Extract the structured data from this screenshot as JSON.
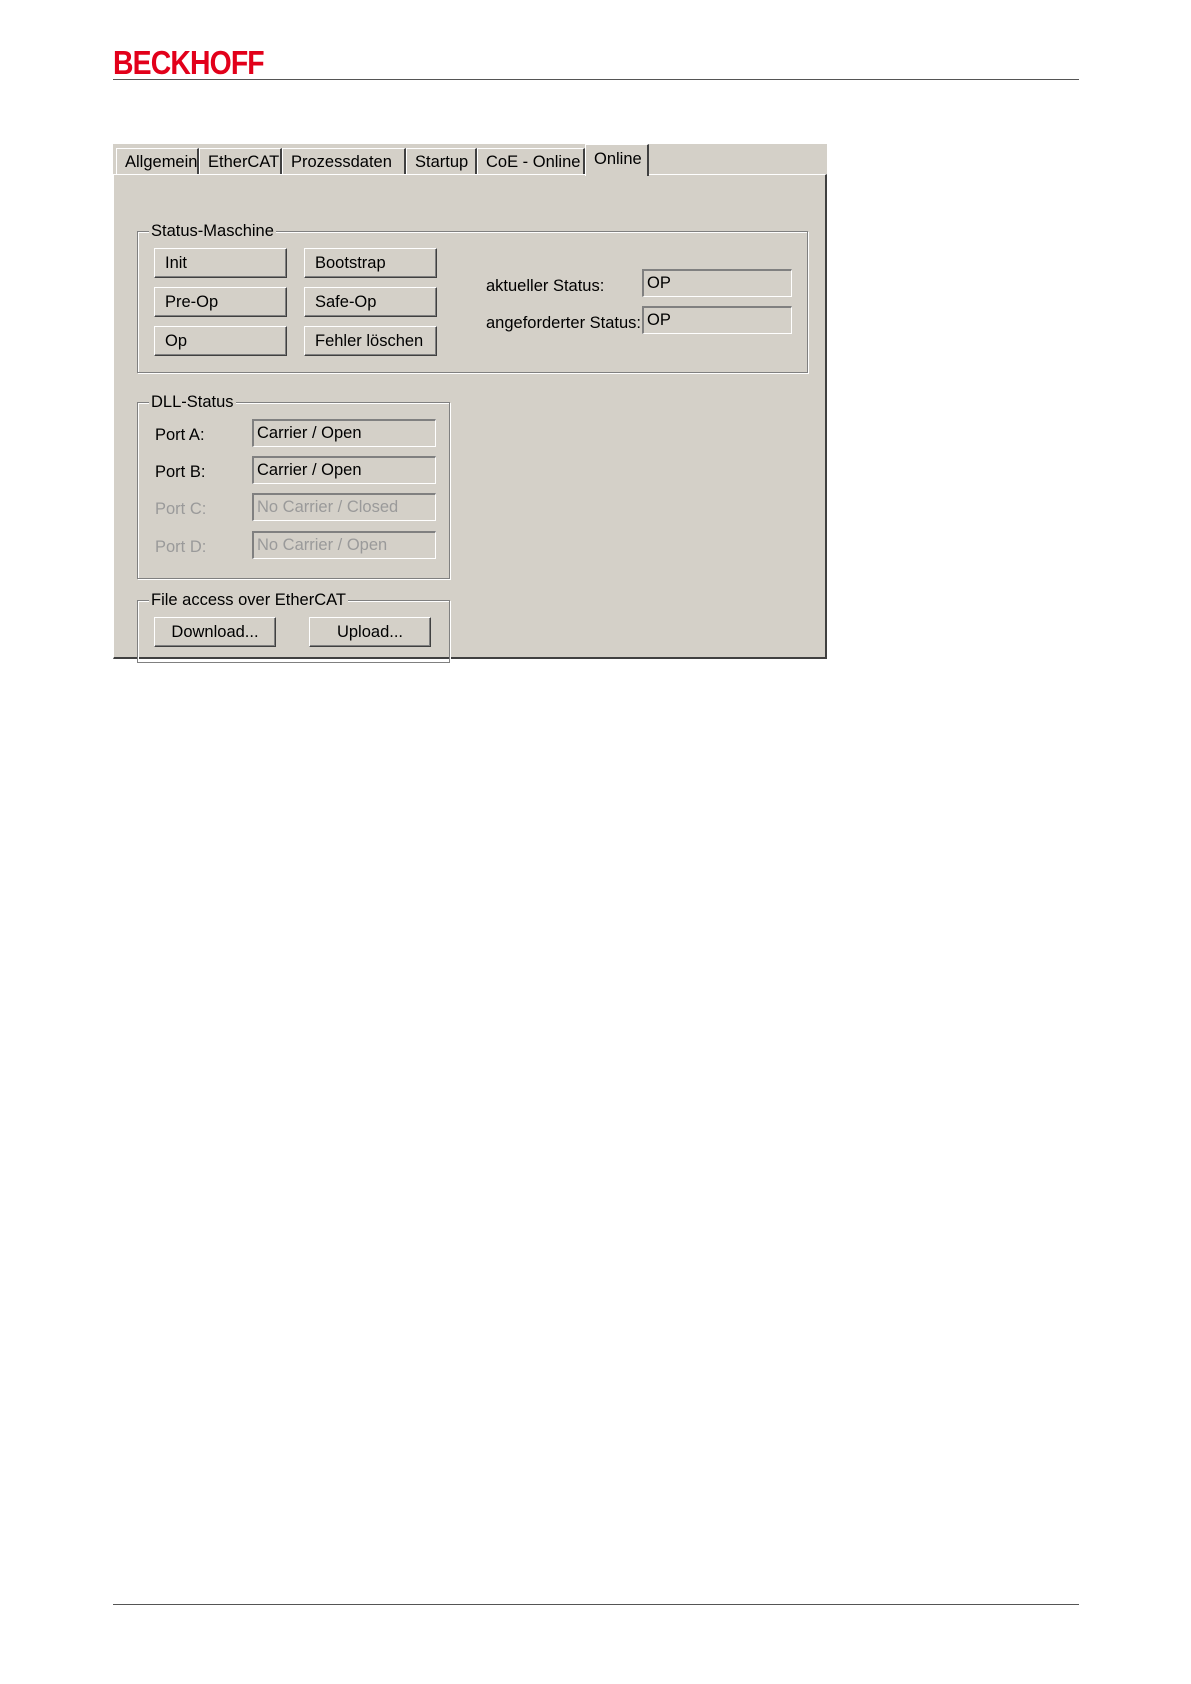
{
  "brand": {
    "logo_text": "BECKHOFF",
    "color": "#e2001a"
  },
  "tabs": [
    {
      "label": "Allgemein"
    },
    {
      "label": "EtherCAT"
    },
    {
      "label": "Prozessdaten"
    },
    {
      "label": "Startup"
    },
    {
      "label": "CoE - Online"
    },
    {
      "label": "Online",
      "active": true
    }
  ],
  "status_machine": {
    "title": "Status-Maschine",
    "buttons": {
      "init": "Init",
      "bootstrap": "Bootstrap",
      "preop": "Pre-Op",
      "safeop": "Safe-Op",
      "op": "Op",
      "clear_errors": "Fehler löschen"
    },
    "current_status_label": "aktueller Status:",
    "current_status_value": "OP",
    "requested_status_label": "angeforderter Status:",
    "requested_status_value": "OP"
  },
  "dll_status": {
    "title": "DLL-Status",
    "ports": [
      {
        "label": "Port A:",
        "value": "Carrier / Open",
        "enabled": true
      },
      {
        "label": "Port B:",
        "value": "Carrier / Open",
        "enabled": true
      },
      {
        "label": "Port C:",
        "value": "No Carrier / Closed",
        "enabled": false
      },
      {
        "label": "Port D:",
        "value": "No Carrier / Open",
        "enabled": false
      }
    ]
  },
  "file_access": {
    "title": "File access over EtherCAT",
    "download_label": "Download...",
    "upload_label": "Upload..."
  }
}
